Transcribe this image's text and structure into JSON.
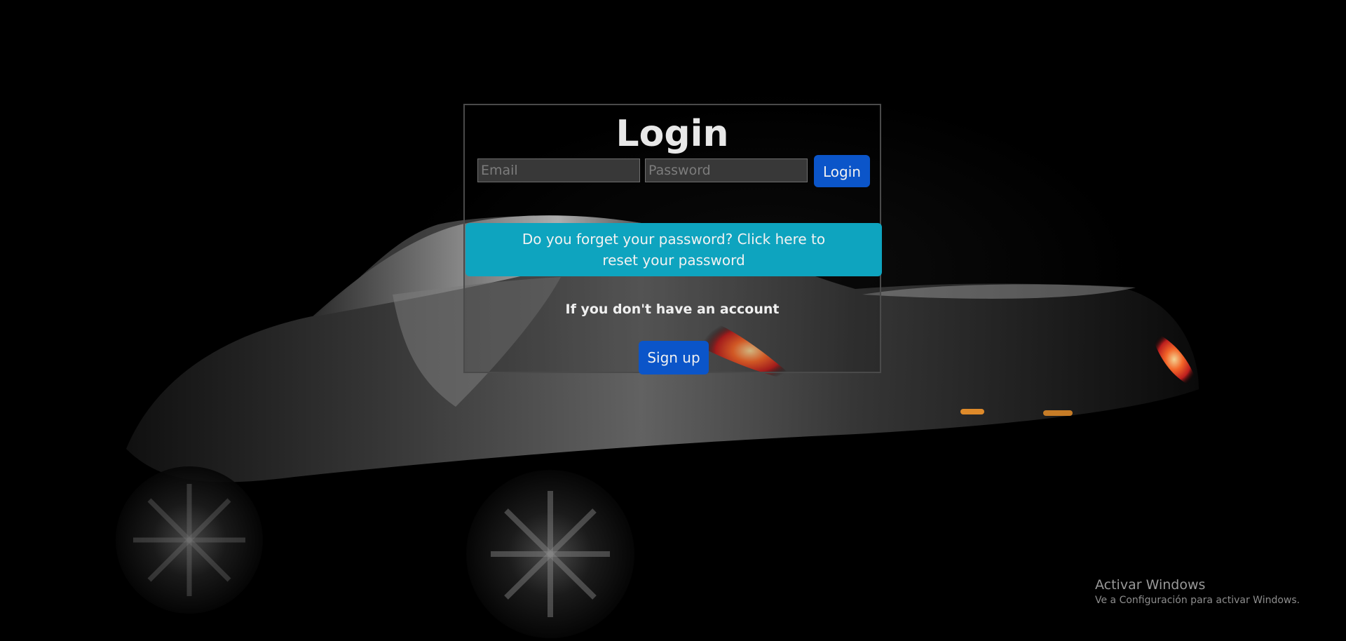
{
  "page": {
    "title": "Login"
  },
  "login_form": {
    "email_placeholder": "Email",
    "password_placeholder": "Password",
    "login_button": "Login"
  },
  "reset_password": {
    "text": "Do you forget your password? Click here to reset your password"
  },
  "signup": {
    "prompt": "If you don't have an account",
    "button": "Sign up"
  },
  "watermark": {
    "title": "Activar Windows",
    "subtitle": "Ve a Configuración para activar Windows."
  },
  "colors": {
    "background": "#000000",
    "panel_border": "#4a4a4a",
    "primary_button": "#0b55c9",
    "reset_banner": "#0ea4bf",
    "input_background": "#383838"
  },
  "icons": {
    "background_image": "sports-car-image"
  }
}
